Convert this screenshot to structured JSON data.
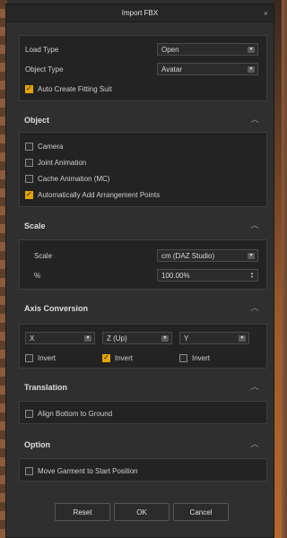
{
  "dialog": {
    "title": "Import FBX",
    "close": "×"
  },
  "main": {
    "load_type": {
      "label": "Load Type",
      "value": "Open"
    },
    "object_type": {
      "label": "Object Type",
      "value": "Avatar"
    },
    "auto_fit": {
      "label": "Auto Create Fitting Suit",
      "checked": true
    }
  },
  "object": {
    "title": "Object",
    "items": [
      {
        "label": "Camera",
        "checked": false
      },
      {
        "label": "Joint Animation",
        "checked": false
      },
      {
        "label": "Cache Animation (MC)",
        "checked": false
      },
      {
        "label": "Automatically Add Arrangement Points",
        "checked": true
      }
    ]
  },
  "scale": {
    "title": "Scale",
    "unit_label": "Scale",
    "unit_value": "cm (DAZ Studio)",
    "percent_label": "%",
    "percent_value": "100.00%"
  },
  "axis": {
    "title": "Axis Conversion",
    "selects": [
      "X",
      "Z (Up)",
      "Y"
    ],
    "inverts": [
      {
        "label": "Invert",
        "checked": false
      },
      {
        "label": "Invert",
        "checked": true
      },
      {
        "label": "Invert",
        "checked": false
      }
    ]
  },
  "translation": {
    "title": "Translation",
    "align_label": "Align Bottom to Ground",
    "checked": false
  },
  "option": {
    "title": "Option",
    "move_label": "Move Garment to Start Position",
    "checked": false
  },
  "buttons": {
    "reset": "Reset",
    "ok": "OK",
    "cancel": "Cancel"
  },
  "colors": {
    "accent": "#e3a300",
    "panel": "#2f2f2f",
    "box": "#232323"
  }
}
